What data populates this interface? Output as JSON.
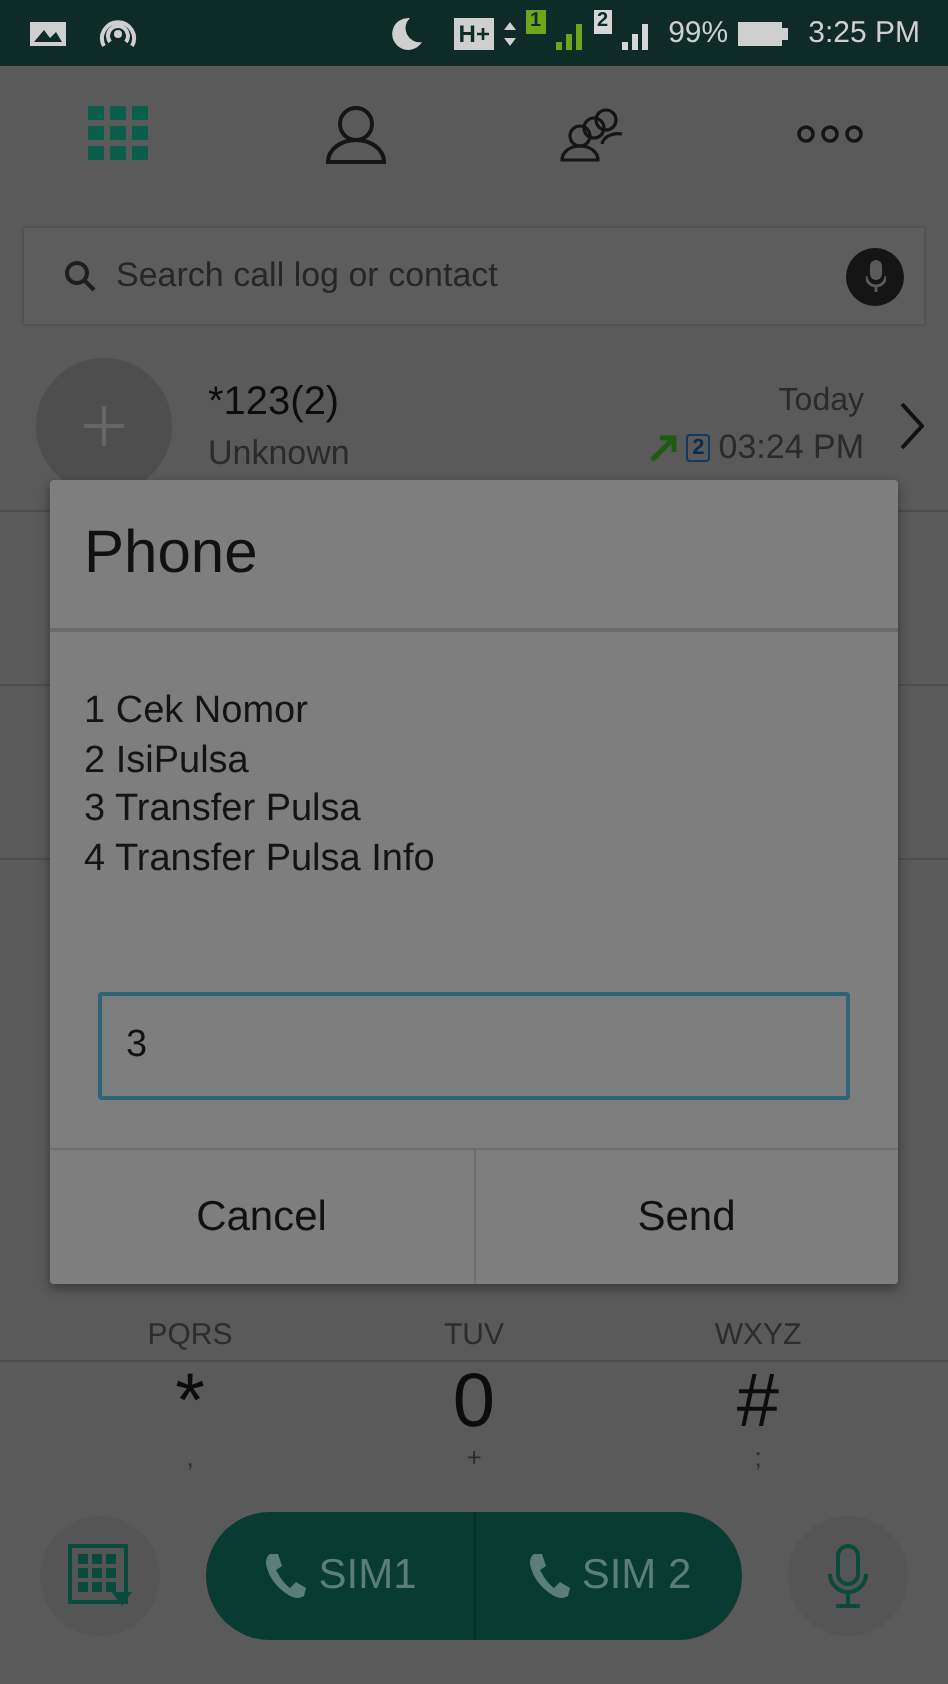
{
  "status_bar": {
    "network": "H+",
    "sims": [
      {
        "label": "1",
        "color": "#6fa51a"
      },
      {
        "label": "2",
        "color": "#d6d6d6"
      }
    ],
    "battery": "99%",
    "time": "3:25 PM"
  },
  "tabs": [
    {
      "kind": "dialpad",
      "selected": true
    },
    {
      "kind": "contact",
      "selected": false
    },
    {
      "kind": "groups",
      "selected": false
    },
    {
      "kind": "more",
      "selected": false
    }
  ],
  "search": {
    "placeholder": "Search call log or contact"
  },
  "call_log": [
    {
      "name": "*123(2)",
      "label": "Unknown",
      "date": "Today",
      "sim": "2",
      "time": "03:24 PM"
    }
  ],
  "keypad": [
    [
      {
        "letters": "PQRS"
      },
      {
        "letters": "TUV"
      },
      {
        "letters": "WXYZ"
      }
    ],
    [
      {
        "digit": "*",
        "sub": ","
      },
      {
        "digit": "0",
        "sub": "+"
      },
      {
        "digit": "#",
        "sub": ";"
      }
    ]
  ],
  "call_button": {
    "sims": [
      "SIM1",
      "SIM 2"
    ]
  },
  "dialog": {
    "title": "Phone",
    "message": [
      "1 Cek Nomor",
      "2 IsiPulsa",
      "3 Transfer Pulsa",
      "4 Transfer Pulsa Info"
    ],
    "input": "3",
    "buttons": [
      "Cancel",
      "Send"
    ]
  }
}
